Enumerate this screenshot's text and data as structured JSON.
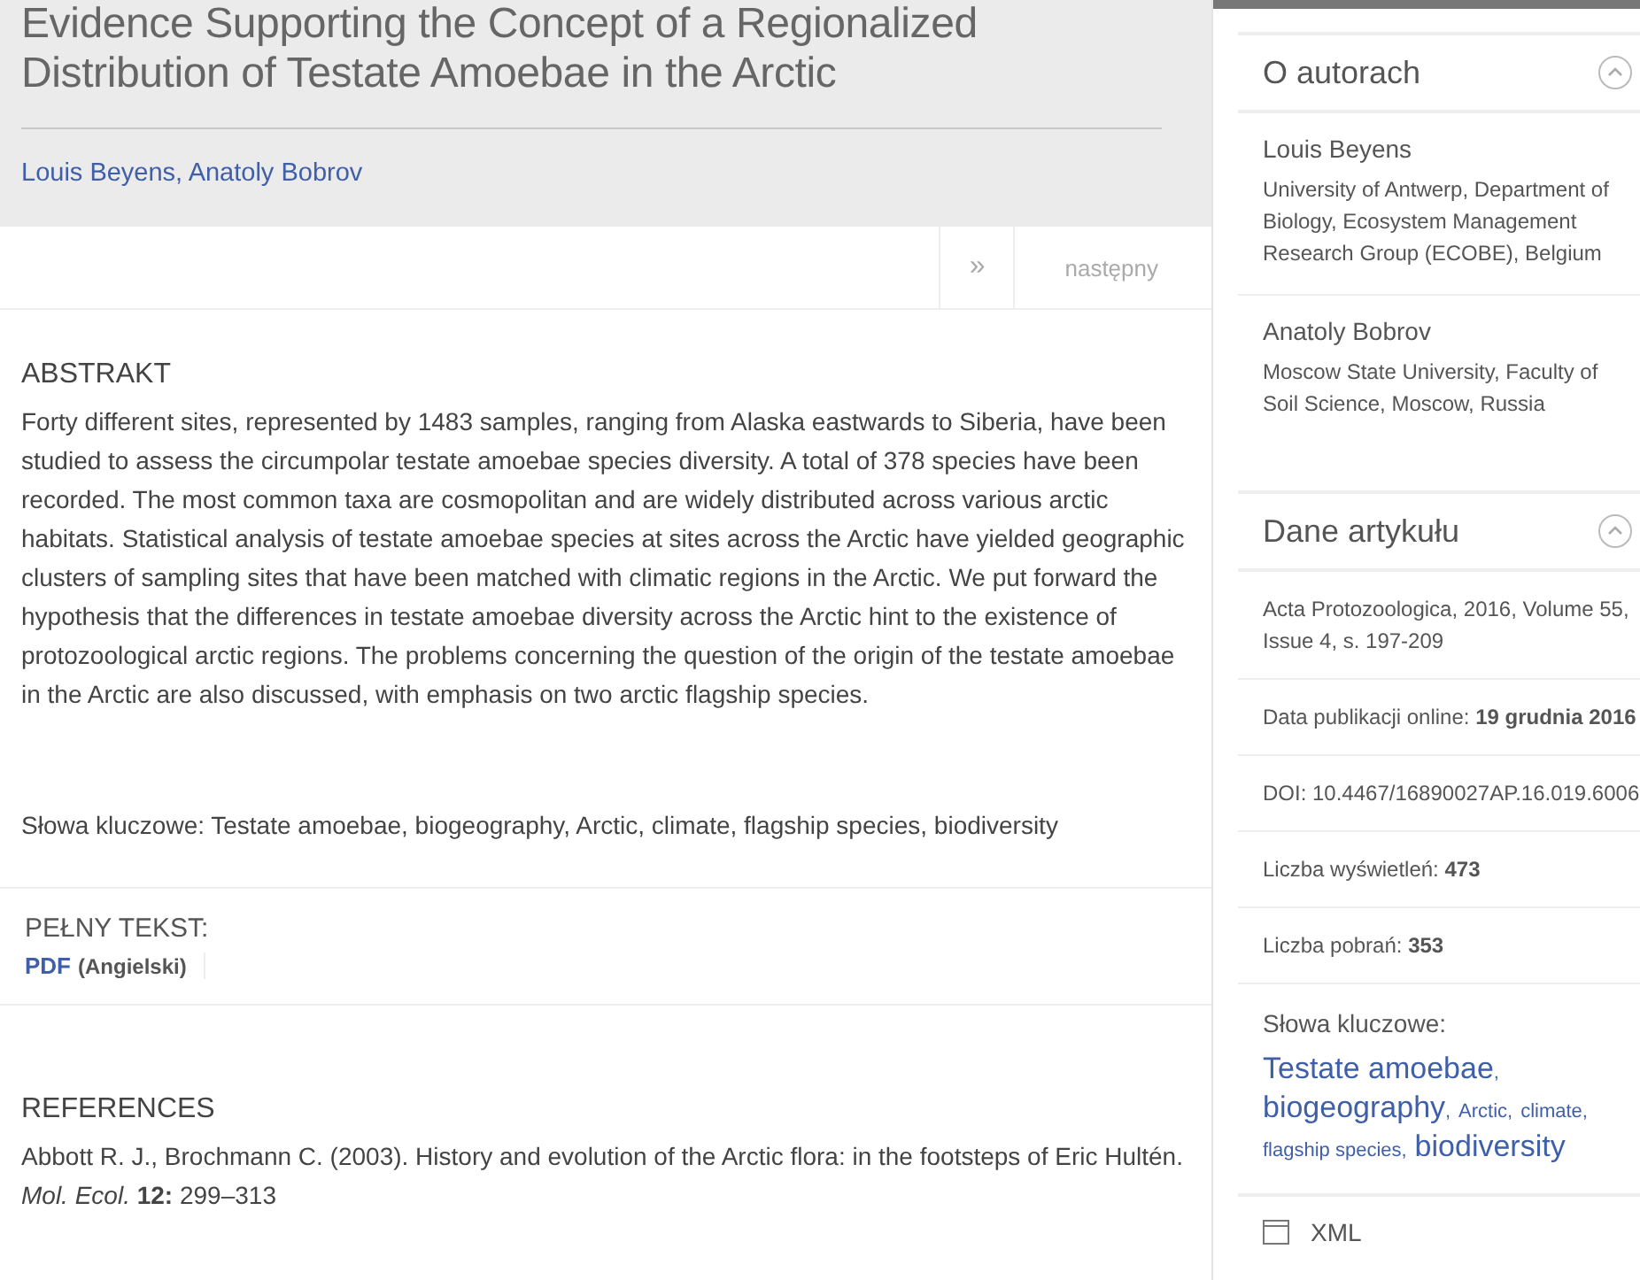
{
  "article": {
    "title": "Evidence Supporting the Concept of a Regionalized Distribution of Testate Amoebae in the Arctic",
    "authors": "Louis Beyens, Anatoly Bobrov"
  },
  "nav": {
    "arrow": "»",
    "next": "następny"
  },
  "abstract": {
    "heading": "ABSTRAKT",
    "text": "Forty different sites, represented by 1483 samples, ranging from Alaska eastwards to Siberia, have been studied to assess the circumpolar testate amoebae species diversity. A total of 378 species have been recorded. The most common taxa are cosmopolitan and are widely distributed across various arctic habitats. Statistical analysis of testate amoebae species at sites across the Arctic have yielded geographic clusters of sampling sites that have been matched with climatic regions in the Arctic. We put forward the hypothesis that the differences in testate amoebae diversity across the Arctic hint to the existence of protozoological arctic regions. The problems concerning the question of the origin of the testate amoebae in the Arctic are also discussed, with emphasis on two arctic flagship species.",
    "keywords": "Słowa kluczowe: Testate amoebae, biogeography, Arctic, climate, flagship species, biodiversity"
  },
  "full_text": {
    "heading": "PEŁNY TEKST:",
    "link": "PDF",
    "language": "(Angielski)"
  },
  "references": {
    "heading": "REFERENCES",
    "items": [
      "Abbott R. J., Brochmann C. (2003). History and evolution of the Arctic flora: in the footsteps of Eric Hultén. *Mol. Ecol.* **12:** 299–313"
    ]
  },
  "sidebar": {
    "panels": [
      {
        "title": "O autorach",
        "expanded": true,
        "kind": "authors",
        "authors": [
          {
            "name": "Louis Beyens",
            "affiliation": "University of Antwerp, Department of Biology, Ecosystem Management Research Group (ECOBE), Belgium"
          },
          {
            "name": "Anatoly Bobrov",
            "affiliation": "Moscow State University, Faculty of Soil Science, Moscow, Russia"
          }
        ]
      },
      {
        "title": "Dane artykułu",
        "expanded": true,
        "kind": "details",
        "rows": [
          "Acta Protozoologica, 2016, Volume 55, Issue 4, s. 197-209",
          "Data publikacji online: **19 grudnia 2016**",
          "DOI: 10.4467/16890027AP.16.019.6006",
          "Liczba wyświetleń: **473**",
          "Liczba pobrań: **353**"
        ],
        "keywords_label": "Słowa kluczowe:",
        "keywords": [
          {
            "text": "Testate amoebae",
            "kind": "large",
            "separator": ","
          },
          {
            "text": "biogeography",
            "kind": "large",
            "separator": ","
          },
          {
            "text": "Arctic",
            "kind": "small",
            "separator": ","
          },
          {
            "text": "climate",
            "kind": "small",
            "separator": ","
          },
          {
            "text": "flagship species",
            "kind": "small",
            "separator": ","
          },
          {
            "text": "biodiversity",
            "kind": "large"
          }
        ],
        "export": "XML"
      }
    ]
  }
}
